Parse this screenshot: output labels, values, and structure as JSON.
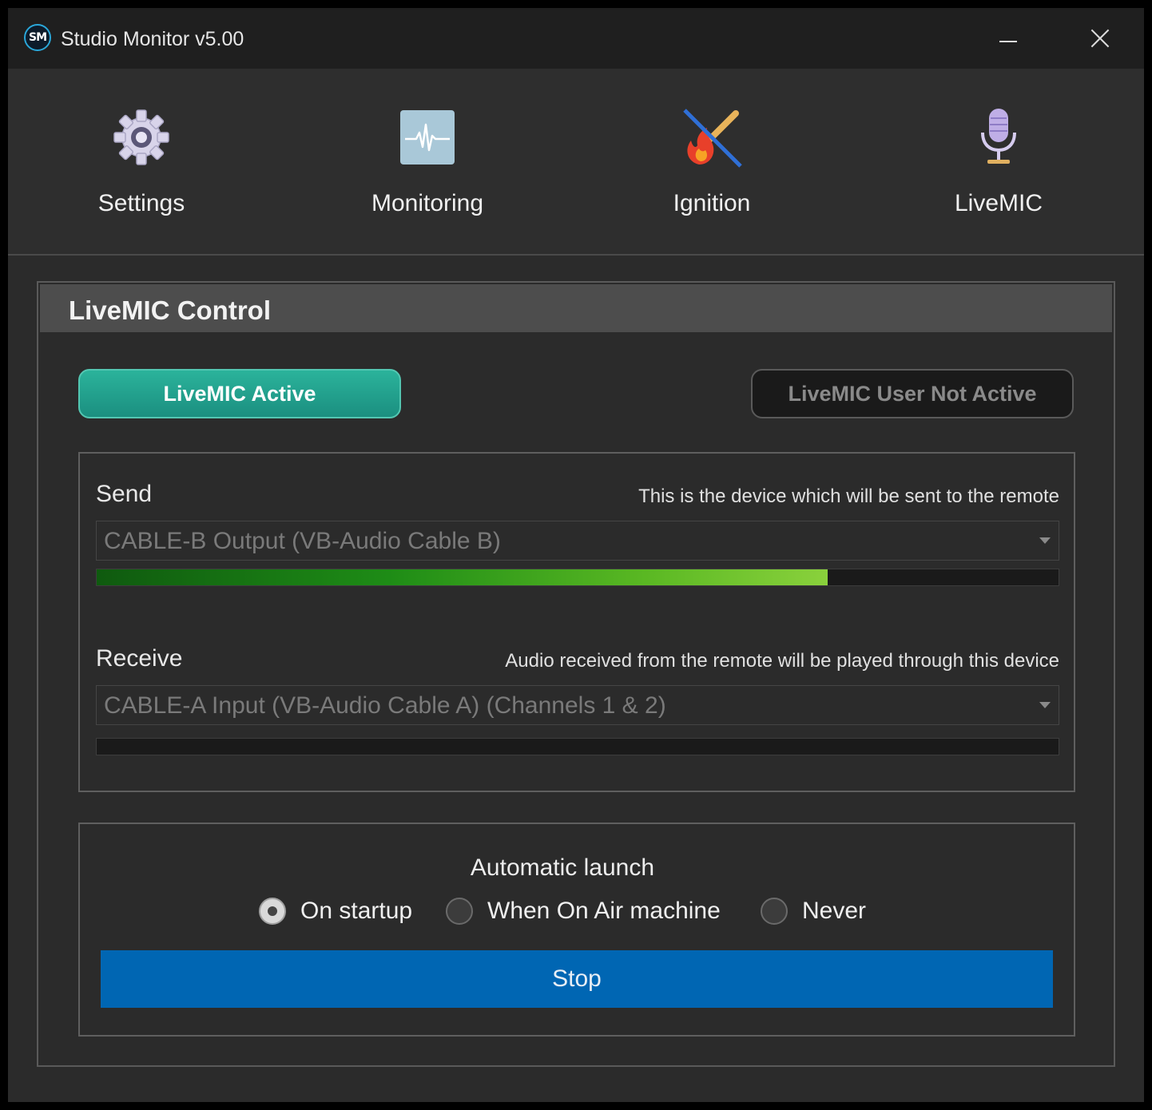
{
  "window": {
    "logo_text": "SM",
    "title": "Studio Monitor v5.00"
  },
  "nav": {
    "items": [
      {
        "label": "Settings",
        "icon": "gear-icon"
      },
      {
        "label": "Monitoring",
        "icon": "waveform-icon"
      },
      {
        "label": "Ignition",
        "icon": "flame-match-crossed-icon"
      },
      {
        "label": "LiveMIC",
        "icon": "microphone-icon"
      }
    ]
  },
  "panel": {
    "title": "LiveMIC Control",
    "status_active": "LiveMIC Active",
    "status_user": "LiveMIC User Not Active"
  },
  "send": {
    "label": "Send",
    "hint": "This is the device which will be sent to the remote",
    "device": "CABLE-B Output (VB-Audio Cable B)",
    "level_percent": 76
  },
  "receive": {
    "label": "Receive",
    "hint": "Audio received from the remote will be played through this device",
    "device": "CABLE-A Input (VB-Audio Cable A) (Channels 1 & 2)",
    "level_percent": 0
  },
  "launch": {
    "title": "Automatic launch",
    "options": [
      {
        "label": "On startup",
        "checked": true
      },
      {
        "label": "When On Air machine",
        "checked": false
      },
      {
        "label": "Never",
        "checked": false
      }
    ],
    "stop_label": "Stop"
  },
  "colors": {
    "accent_teal": "#1f9e8a",
    "stop_blue": "#0066b3",
    "meter_green": "#8ad13c"
  }
}
